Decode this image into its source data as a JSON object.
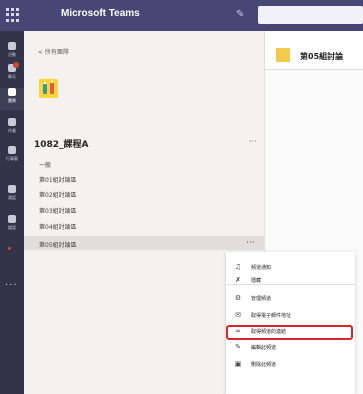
{
  "app": {
    "title": "Microsoft Teams"
  },
  "rail": {
    "items": [
      {
        "label": "活動"
      },
      {
        "label": "聊天"
      },
      {
        "label": "團隊"
      },
      {
        "label": "作業"
      },
      {
        "label": "行事曆"
      },
      {
        "label": "通話"
      },
      {
        "label": "檔案"
      }
    ]
  },
  "panel": {
    "back_label": "< 所有團隊",
    "team_name": "1082_課程A",
    "team_more": "···",
    "channels": [
      "一般",
      "第01組討論區",
      "第02組討論區",
      "第03組討論區",
      "第04組討論區",
      "第05組討論區"
    ],
    "channel_more": "···"
  },
  "main": {
    "title": "第05組討論"
  },
  "context_menu": {
    "items": [
      {
        "icon": "bell-icon",
        "label": "頻道通知"
      },
      {
        "icon": "pin-icon",
        "label": "隱藏"
      },
      {
        "icon": "gear-icon",
        "label": "管理頻道"
      },
      {
        "icon": "mail-icon",
        "label": "取得電子郵件地址"
      },
      {
        "icon": "link-icon",
        "label": "取得頻道的連結"
      },
      {
        "icon": "pencil-icon",
        "label": "編輯此頻道"
      },
      {
        "icon": "trash-icon",
        "label": "刪除此頻道"
      }
    ],
    "highlighted_index": 4,
    "highlight_color": "#d9262d"
  },
  "colors": {
    "header": "#464775",
    "rail": "#33344a",
    "brand": "#6264a7"
  }
}
